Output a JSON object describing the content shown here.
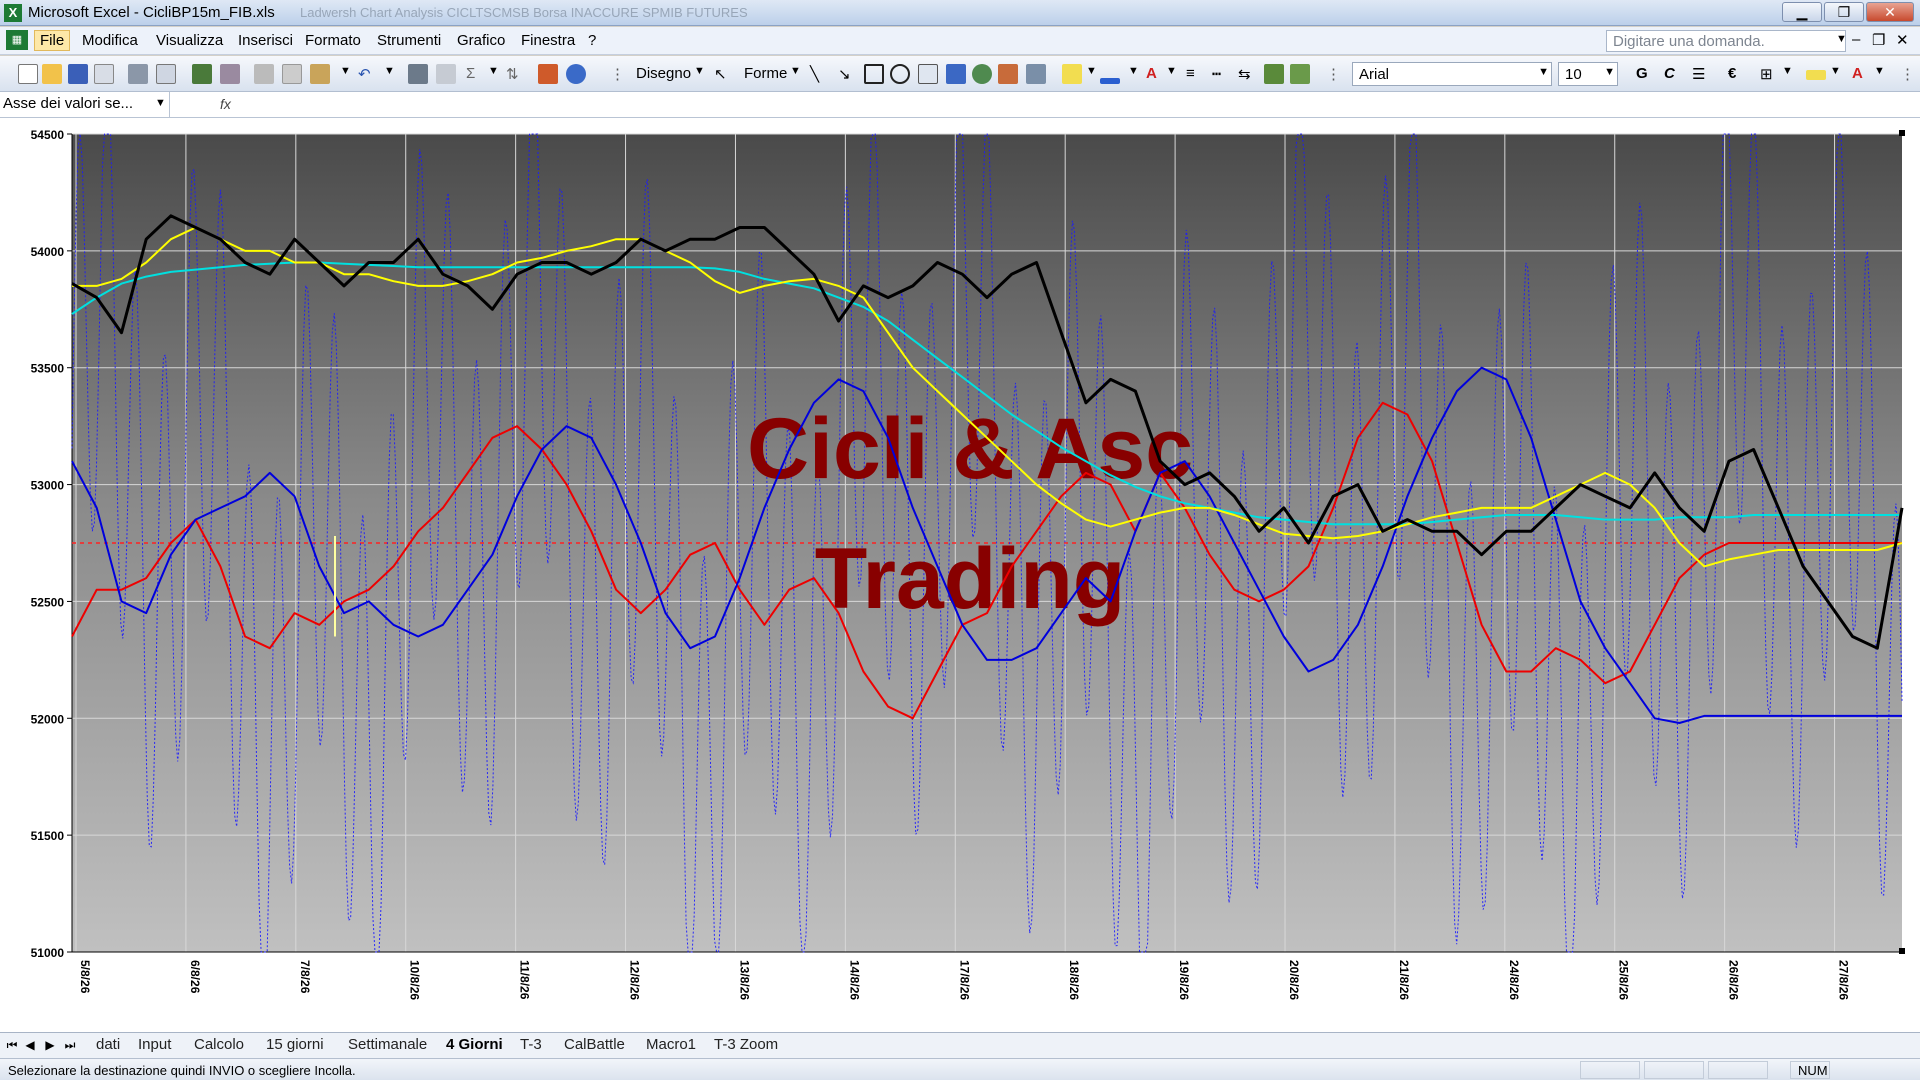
{
  "window": {
    "title": "Microsoft Excel - CicliBP15m_FIB.xls",
    "background_tabs": "Ladwersh  Chart Analysis  CICLTSCMSB  Borsa  INACCURE  SPMIB FUTURES"
  },
  "menu": {
    "items": [
      "File",
      "Modifica",
      "Visualizza",
      "Inserisci",
      "Formato",
      "Strumenti",
      "Grafico",
      "Finestra",
      "?"
    ],
    "ask_placeholder": "Digitare una domanda."
  },
  "toolbar": {
    "drawing_label": "Disegno",
    "shapes_label": "Forme",
    "font_name": "Arial",
    "font_size": "10",
    "bold_label": "G",
    "italic_label": "C",
    "euro_label": "€"
  },
  "formula_bar": {
    "name_box": "Asse dei valori se...",
    "fx_label": "fx"
  },
  "chart": {
    "watermark_line1": "Cicli & Asc",
    "watermark_line2": "Trading",
    "colors": {
      "price": "#000000",
      "fast_ma": "#ffff00",
      "slow_ma": "#00e0e0",
      "red_cycle": "#ee0000",
      "blue_cycle": "#0000dd",
      "dotted_osc": "#1a1aff",
      "ref_line": "#ff2020",
      "marker": "#ffffa0",
      "watermark": "#880000"
    }
  },
  "chart_data": {
    "type": "line",
    "yticks": [
      "54500",
      "54000",
      "53500",
      "53000",
      "52500",
      "52000",
      "51500",
      "51000"
    ],
    "ylim": [
      51000,
      54500
    ],
    "xticks": [
      "5/8/26",
      "6/8/26",
      "7/8/26",
      "10/8/26",
      "11/8/26",
      "12/8/26",
      "13/8/26",
      "14/8/26",
      "17/8/26",
      "18/8/26",
      "19/8/26",
      "20/8/26",
      "21/8/26",
      "24/8/26",
      "25/8/26",
      "26/8/26",
      "27/8/26"
    ],
    "reference_level": 52750,
    "grid": true,
    "series": [
      {
        "key": "price",
        "color": "#000000",
        "values": [
          53860,
          53800,
          53650,
          54050,
          54150,
          54100,
          54050,
          53950,
          53900,
          54050,
          53950,
          53850,
          53950,
          53950,
          54050,
          53900,
          53850,
          53750,
          53900,
          53950,
          53950,
          53900,
          53950,
          54050,
          54000,
          54050,
          54050,
          54100,
          54100,
          54000,
          53900,
          53700,
          53850,
          53800,
          53850,
          53950,
          53900,
          53800,
          53900,
          53950,
          53650,
          53350,
          53450,
          53400,
          53100,
          53000,
          53050,
          52950,
          52800,
          52900,
          52750,
          52950,
          53000,
          52800,
          52850,
          52800,
          52800,
          52700,
          52800,
          52800,
          52900,
          53000,
          52950,
          52900,
          53050,
          52900,
          52800,
          53100,
          53150,
          52900,
          52650,
          52500,
          52350,
          52300,
          52900
        ]
      },
      {
        "key": "fast_ma",
        "color": "#ffff00",
        "values": [
          53850,
          53850,
          53880,
          53950,
          54050,
          54100,
          54050,
          54000,
          54000,
          53950,
          53950,
          53900,
          53900,
          53870,
          53850,
          53850,
          53870,
          53900,
          53950,
          53970,
          54000,
          54020,
          54050,
          54050,
          54000,
          53950,
          53870,
          53820,
          53850,
          53870,
          53880,
          53850,
          53800,
          53650,
          53500,
          53400,
          53300,
          53200,
          53100,
          53000,
          52920,
          52850,
          52820,
          52850,
          52880,
          52900,
          52900,
          52870,
          52830,
          52790,
          52780,
          52770,
          52780,
          52800,
          52830,
          52860,
          52880,
          52900,
          52900,
          52900,
          52950,
          53000,
          53050,
          53000,
          52900,
          52750,
          52650,
          52680,
          52700,
          52720,
          52720,
          52720,
          52720,
          52720,
          52750
        ]
      },
      {
        "key": "slow_ma",
        "color": "#00e0e0",
        "values": [
          53730,
          53800,
          53860,
          53890,
          53910,
          53920,
          53930,
          53940,
          53945,
          53950,
          53950,
          53945,
          53940,
          53935,
          53930,
          53930,
          53930,
          53930,
          53930,
          53930,
          53930,
          53930,
          53930,
          53930,
          53930,
          53930,
          53925,
          53910,
          53880,
          53860,
          53840,
          53800,
          53760,
          53700,
          53620,
          53540,
          53460,
          53380,
          53300,
          53230,
          53160,
          53100,
          53040,
          52990,
          52950,
          52920,
          52900,
          52880,
          52860,
          52850,
          52840,
          52830,
          52830,
          52830,
          52830,
          52840,
          52850,
          52860,
          52870,
          52870,
          52870,
          52860,
          52850,
          52850,
          52850,
          52860,
          52860,
          52860,
          52870,
          52870,
          52870,
          52870,
          52870,
          52870,
          52870
        ]
      },
      {
        "key": "red_cycle",
        "color": "#ee0000",
        "values": [
          52350,
          52550,
          52550,
          52600,
          52750,
          52850,
          52650,
          52350,
          52300,
          52450,
          52400,
          52500,
          52550,
          52650,
          52800,
          52900,
          53050,
          53200,
          53250,
          53150,
          53000,
          52800,
          52550,
          52450,
          52550,
          52700,
          52750,
          52550,
          52400,
          52550,
          52600,
          52450,
          52200,
          52050,
          52000,
          52200,
          52400,
          52450,
          52650,
          52800,
          52950,
          53050,
          53000,
          52800,
          53050,
          52900,
          52700,
          52550,
          52500,
          52550,
          52650,
          52900,
          53200,
          53350,
          53300,
          53100,
          52750,
          52400,
          52200,
          52200,
          52300,
          52250,
          52150,
          52200,
          52400,
          52600,
          52700,
          52750,
          52750,
          52750,
          52750,
          52750,
          52750,
          52750,
          52750
        ]
      },
      {
        "key": "blue_cycle",
        "color": "#0000dd",
        "values": [
          53100,
          52900,
          52500,
          52450,
          52700,
          52850,
          52900,
          52950,
          53050,
          52950,
          52650,
          52450,
          52500,
          52400,
          52350,
          52400,
          52550,
          52700,
          52950,
          53150,
          53250,
          53200,
          53000,
          52750,
          52450,
          52300,
          52350,
          52600,
          52900,
          53150,
          53350,
          53450,
          53400,
          53200,
          52900,
          52650,
          52400,
          52250,
          52250,
          52300,
          52450,
          52600,
          52500,
          52800,
          53050,
          53100,
          52950,
          52750,
          52550,
          52350,
          52200,
          52250,
          52400,
          52650,
          52950,
          53200,
          53400,
          53500,
          53450,
          53200,
          52850,
          52500,
          52300,
          52150,
          52000,
          51980,
          52010,
          52010,
          52010,
          52010,
          52010,
          52010,
          52010,
          52010,
          52010
        ]
      }
    ]
  },
  "sheet_tabs": {
    "items": [
      "dati",
      "Input",
      "Calcolo",
      "15 giorni",
      "Settimanale",
      "4 Giorni",
      "T-3",
      "CalBattle",
      "Macro1",
      "T-3 Zoom"
    ],
    "active": "4 Giorni"
  },
  "status": {
    "message": "Selezionare la destinazione quindi INVIO o scegliere Incolla.",
    "num": "NUM"
  }
}
